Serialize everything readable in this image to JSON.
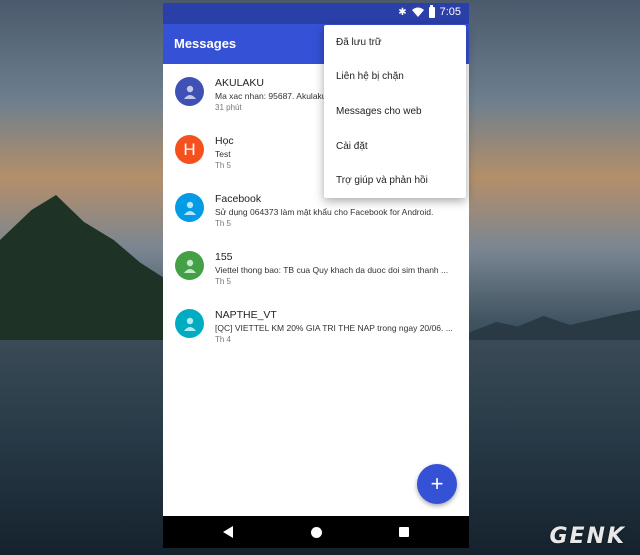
{
  "status_bar": {
    "time": "7:05"
  },
  "app_bar": {
    "title": "Messages"
  },
  "conversations": [
    {
      "name": "AKULAKU",
      "snippet": "Ma xac nhan: 95687. Akulaku",
      "time": "31 phút",
      "avatar_color": "#3f51b5",
      "avatar_type": "person-icon",
      "initial": ""
    },
    {
      "name": "Học",
      "snippet": "Test",
      "time": "Th 5",
      "avatar_color": "#f4511e",
      "avatar_type": "letter",
      "initial": "H"
    },
    {
      "name": "Facebook",
      "snippet": "Sử dụng 064373 làm mật khẩu cho Facebook for Android.",
      "time": "Th 5",
      "avatar_color": "#039be5",
      "avatar_type": "person-icon",
      "initial": ""
    },
    {
      "name": "155",
      "snippet": "Viettel thong bao: TB cua Quy khach da duoc doi sim thanh ...",
      "time": "Th 5",
      "avatar_color": "#43a047",
      "avatar_type": "person-icon",
      "initial": ""
    },
    {
      "name": "NAPTHE_VT",
      "snippet": "[QC] VIETTEL KM 20% GIA TRI THE NAP trong ngay 20/06. ...",
      "time": "Th 4",
      "avatar_color": "#00acc1",
      "avatar_type": "person-icon",
      "initial": ""
    }
  ],
  "menu": {
    "items": [
      {
        "label": "Đã lưu trữ"
      },
      {
        "label": "Liên hệ bị chặn"
      },
      {
        "label": "Messages cho web"
      },
      {
        "label": "Cài đặt"
      },
      {
        "label": "Trợ giúp và phản hồi"
      }
    ]
  },
  "fab": {
    "icon": "plus-icon",
    "label": "+"
  },
  "watermark": {
    "text": "GENK"
  },
  "colors": {
    "primary": "#3551d5",
    "status_bar": "#2a3fa8"
  }
}
